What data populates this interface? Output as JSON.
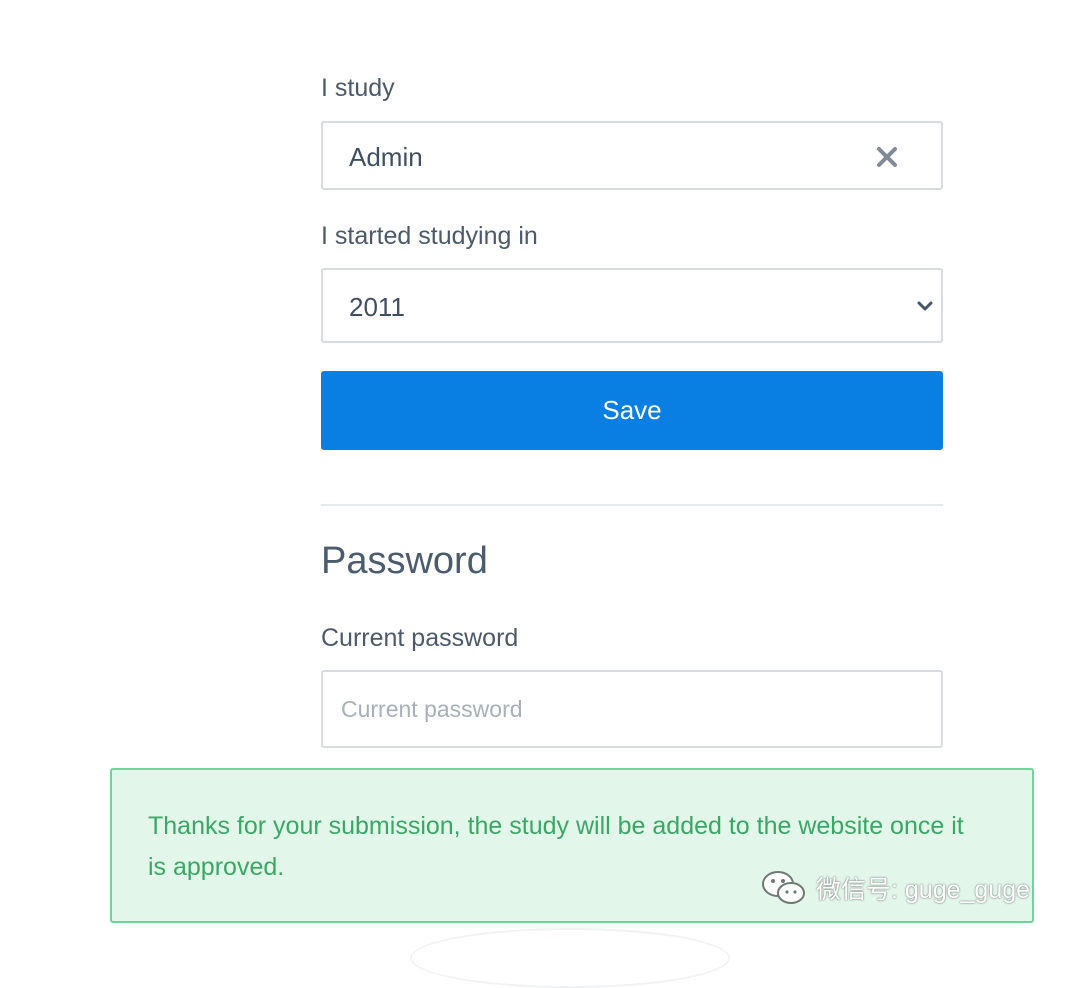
{
  "study": {
    "label": "I study",
    "value": "Admin",
    "clear_icon": "close-icon"
  },
  "start_year": {
    "label": "I started studying in",
    "value": "2011",
    "dropdown_icon": "chevron-down-icon"
  },
  "save_button": {
    "label": "Save",
    "color": "#0a7fe3"
  },
  "password_section": {
    "title": "Password",
    "current_password": {
      "label": "Current password",
      "placeholder": "Current password",
      "value": ""
    }
  },
  "alert": {
    "message": "Thanks for your submission, the study will be added to the website once it is approved.",
    "background_color": "#e3f6ea",
    "border_color": "#6fd39c",
    "text_color": "#3aa865"
  },
  "watermark": {
    "text": "微信号: guge_guge",
    "icon": "wechat-icon"
  }
}
